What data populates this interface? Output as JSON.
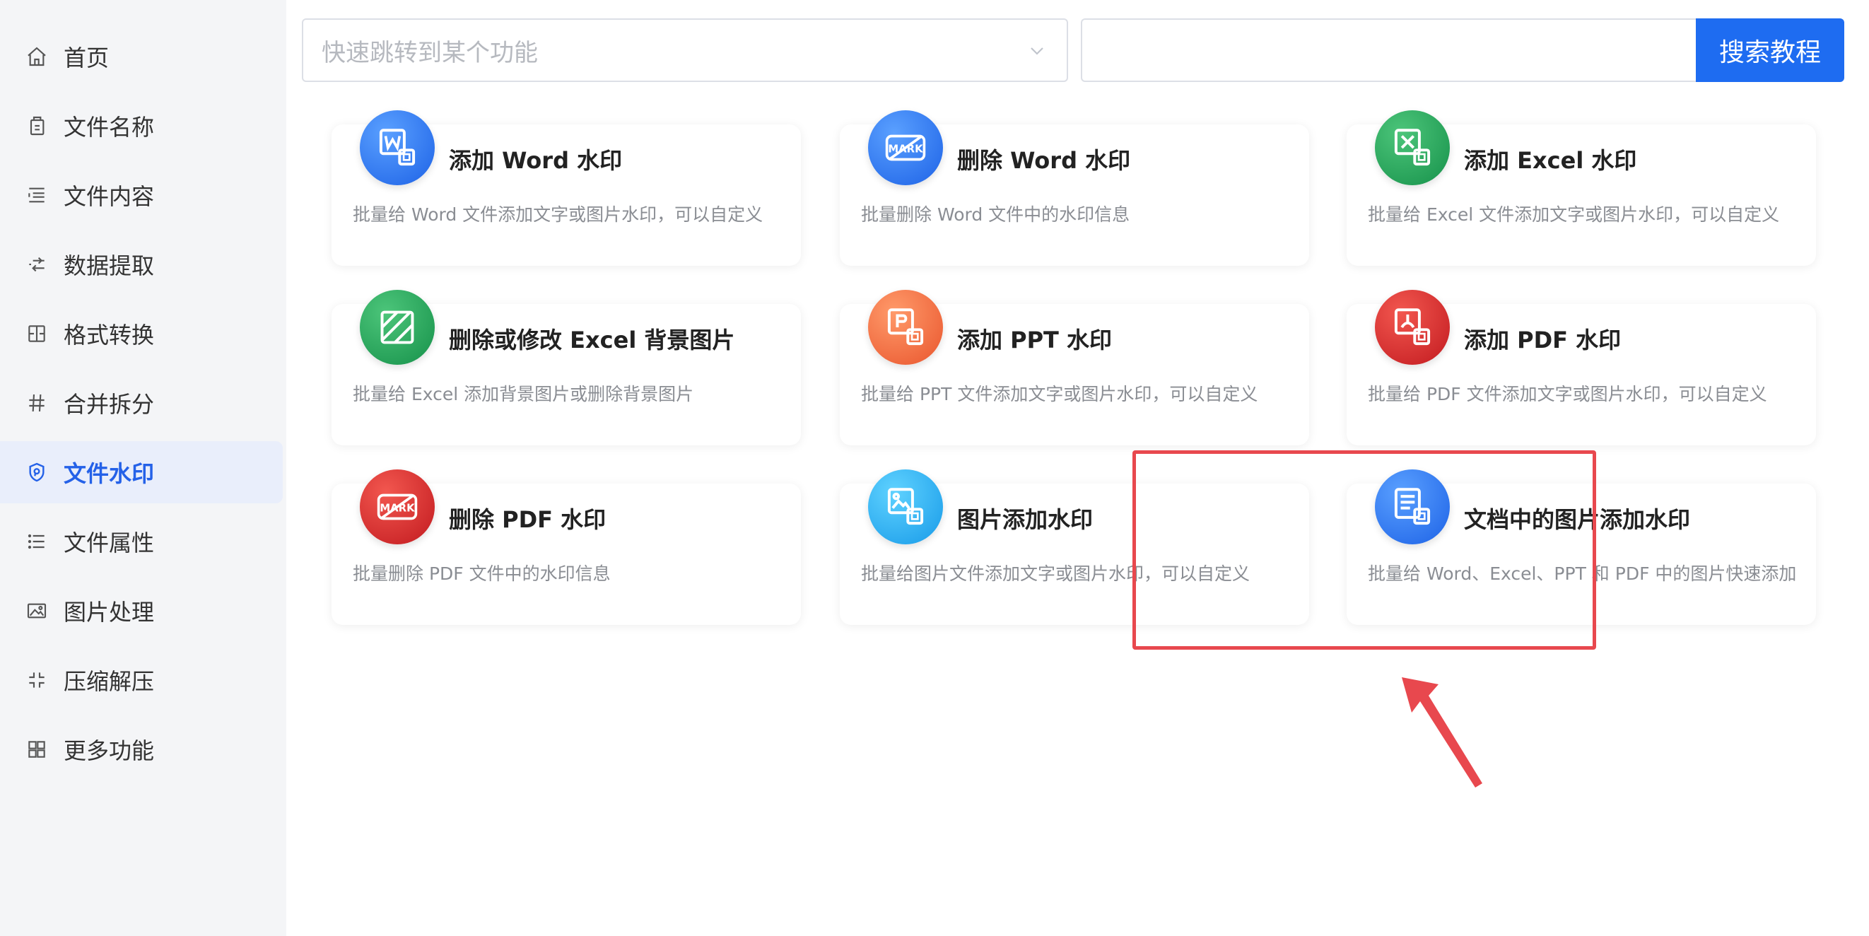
{
  "sidebar": {
    "items": [
      {
        "label": "首页",
        "icon": "home-icon"
      },
      {
        "label": "文件名称",
        "icon": "file-copy-icon"
      },
      {
        "label": "文件内容",
        "icon": "list-icon"
      },
      {
        "label": "数据提取",
        "icon": "extract-icon"
      },
      {
        "label": "格式转换",
        "icon": "convert-icon"
      },
      {
        "label": "合并拆分",
        "icon": "hash-icon"
      },
      {
        "label": "文件水印",
        "icon": "shield-icon",
        "active": true
      },
      {
        "label": "文件属性",
        "icon": "list-icon"
      },
      {
        "label": "图片处理",
        "icon": "image-icon"
      },
      {
        "label": "压缩解压",
        "icon": "compress-icon"
      },
      {
        "label": "更多功能",
        "icon": "grid-icon"
      }
    ]
  },
  "search": {
    "placeholder": "快速跳转到某个功能",
    "tutorial_value": "",
    "tutorial_button": "搜索教程"
  },
  "cards": [
    {
      "title": "添加 Word 水印",
      "desc": "批量给 Word 文件添加文字或图片水印，可以自定义",
      "icon": "word-watermark-icon",
      "color": "#1d62e6"
    },
    {
      "title": "删除 Word 水印",
      "desc": "批量删除 Word 文件中的水印信息",
      "icon": "mark-remove-icon",
      "color": "#1d62e6"
    },
    {
      "title": "添加 Excel 水印",
      "desc": "批量给 Excel 文件添加文字或图片水印，可以自定义",
      "icon": "excel-watermark-icon",
      "color": "#16914a"
    },
    {
      "title": "删除或修改 Excel 背景图片",
      "desc": "批量给 Excel 添加背景图片或删除背景图片",
      "icon": "excel-background-icon",
      "color": "#16914a"
    },
    {
      "title": "添加 PPT 水印",
      "desc": "批量给 PPT 文件添加文字或图片水印，可以自定义",
      "icon": "ppt-watermark-icon",
      "color": "#e9552d"
    },
    {
      "title": "添加 PDF 水印",
      "desc": "批量给 PDF 文件添加文字或图片水印，可以自定义",
      "icon": "pdf-watermark-icon",
      "color": "#c21a1f"
    },
    {
      "title": "删除 PDF 水印",
      "desc": "批量删除 PDF 文件中的水印信息",
      "icon": "mark-remove-icon",
      "color": "#c21a1f"
    },
    {
      "title": "图片添加水印",
      "desc": "批量给图片文件添加文字或图片水印，可以自定义",
      "icon": "image-watermark-icon",
      "color": "#179ae8"
    },
    {
      "title": "文档中的图片添加水印",
      "desc": "批量给 Word、Excel、PPT 和 PDF 中的图片快速添加",
      "icon": "document-image-icon",
      "color": "#1d62e6"
    }
  ],
  "annotation": {
    "highlight_color": "#e8484e"
  },
  "mark_text": "MARK"
}
